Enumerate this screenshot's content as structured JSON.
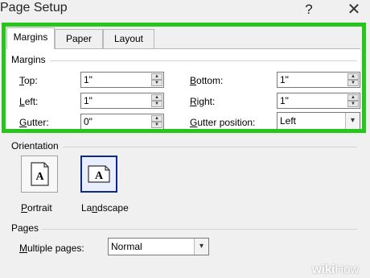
{
  "window": {
    "title": "Page Setup",
    "help_glyph": "?",
    "close_glyph": "✕"
  },
  "tabs": [
    {
      "label": "Margins",
      "active": true
    },
    {
      "label": "Paper",
      "active": false
    },
    {
      "label": "Layout",
      "active": false
    }
  ],
  "margins": {
    "group_label": "Margins",
    "top": {
      "label": "Top:",
      "value": "1\""
    },
    "bottom": {
      "label": "Bottom:",
      "value": "1\""
    },
    "left": {
      "label": "Left:",
      "value": "1\""
    },
    "right": {
      "label": "Right:",
      "value": "1\""
    },
    "gutter": {
      "label": "Gutter:",
      "value": "0\""
    },
    "gutter_position": {
      "label": "Gutter position:",
      "value": "Left"
    }
  },
  "orientation": {
    "group_label": "Orientation",
    "portrait_label": "Portrait",
    "landscape_label": "Landscape",
    "selected": "landscape",
    "glyph": "A"
  },
  "pages": {
    "group_label": "Pages",
    "multiple_pages_label": "Multiple pages:",
    "multiple_pages_value": "Normal"
  },
  "watermark": {
    "part1": "wiki",
    "part2": "How"
  },
  "colors": {
    "highlight": "#28c61c",
    "selected_border": "#0d2a8a"
  }
}
